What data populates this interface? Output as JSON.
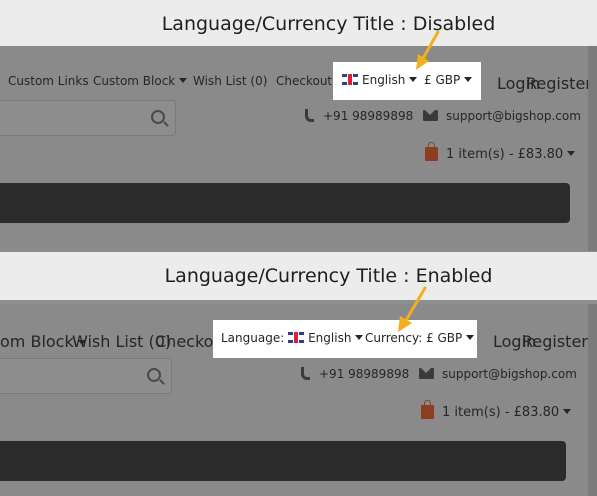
{
  "sections": [
    {
      "title": "Language/Currency Title : Disabled",
      "nav": [
        "Custom Links",
        "Custom Block",
        "Wish List (0)",
        "Checkout"
      ],
      "language_label": "",
      "language_value": "English",
      "currency_label": "",
      "currency_value": "£ GBP",
      "login": "Login",
      "register": "Register",
      "phone": "+91 98989898",
      "email": "support@bigshop.com",
      "cart": "1 item(s) - £83.80"
    },
    {
      "title": "Language/Currency Title : Enabled",
      "nav": [
        "om Block",
        "Wish List (0)",
        "Checkout"
      ],
      "language_label": "Language:",
      "language_value": "English",
      "currency_label": "Currency:",
      "currency_value": "£ GBP",
      "login": "Login",
      "register": "Register",
      "phone": "+91 98989898",
      "email": "support@bigshop.com",
      "cart": "1 item(s) - £83.80"
    }
  ],
  "colors": {
    "arrow": "#f2b01e",
    "overlay": "#8a8a8a",
    "highlight": "#ffffff",
    "bag": "#8b3e20"
  }
}
